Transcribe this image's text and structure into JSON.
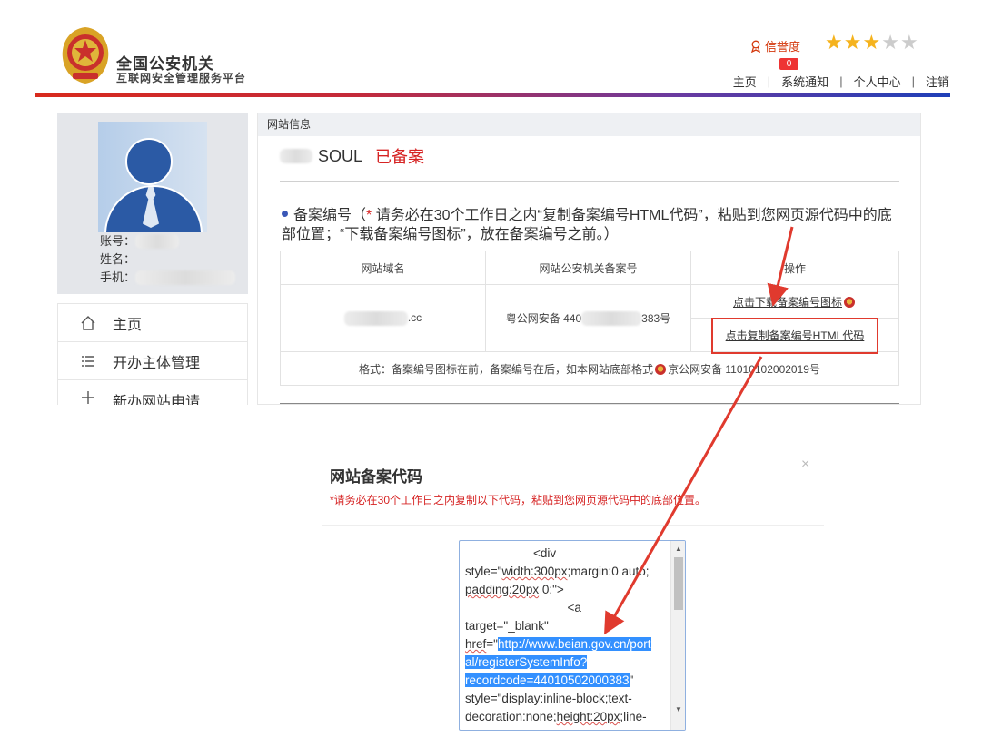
{
  "header": {
    "title": "全国公安机关",
    "subtitle": "互联网安全管理服务平台",
    "credit_label": "信誉度",
    "stars_total": 5,
    "stars_filled": 3,
    "notice_count": "0",
    "nav": [
      "主页",
      "系统通知",
      "个人中心",
      "注销"
    ]
  },
  "profile": {
    "account_label": "账号：",
    "name_label": "姓名：",
    "phone_label": "手机："
  },
  "sidebar": {
    "items": [
      {
        "label": "主页",
        "icon": "home-icon"
      },
      {
        "label": "开办主体管理",
        "icon": "list-icon"
      },
      {
        "label": "新办网站申请",
        "icon": "plus-icon"
      }
    ]
  },
  "content": {
    "section_title": "网站信息",
    "site_name": "SOUL",
    "site_status": "已备案",
    "beian_prefix": "备案编号（",
    "beian_star": "*",
    "beian_text": " 请务必在30个工作日之内“复制备案编号HTML代码”，粘贴到您网页源代码中的底部位置；“下载备案编号图标”，放在备案编号之前。）",
    "table": {
      "headers": [
        "网站域名",
        "网站公安机关备案号",
        "操作"
      ],
      "domain_suffix": ".cc",
      "record_prefix": "粤公网安备 440",
      "record_suffix": "383号",
      "download_link": "点击下载备案编号图标",
      "copy_link": "点击复制备案编号HTML代码",
      "format_prefix": "格式：备案编号图标在前，备案编号在后，如本网站底部格式",
      "format_example": "京公网安备 11010102002019号"
    }
  },
  "dialog": {
    "title": "网站备案代码",
    "close": "×",
    "hint": "*请务必在30个工作日之内复制以下代码，粘贴到您网页源代码中的底部位置。",
    "code": {
      "l1": "                    <div",
      "l2a": "style=\"",
      "l2b": "width:300px",
      "l2c": ";margin:0 auto;",
      "l3a": "padding:20px",
      "l3b": " 0;\">",
      "l4": "                              <a",
      "l5": "target=\"_blank\"",
      "l6a": "href",
      "l6b": "=\"",
      "l6c": "http://www.beian.gov.cn/port",
      "l7": "al/registerSystemInfo?",
      "l8a": "recordcode=44010502000383",
      "l8b": "\"",
      "l9": "style=\"display:inline-block;text-",
      "l10a": "decoration:none;",
      "l10b": "height:20px",
      "l10c": ";line-"
    }
  }
}
